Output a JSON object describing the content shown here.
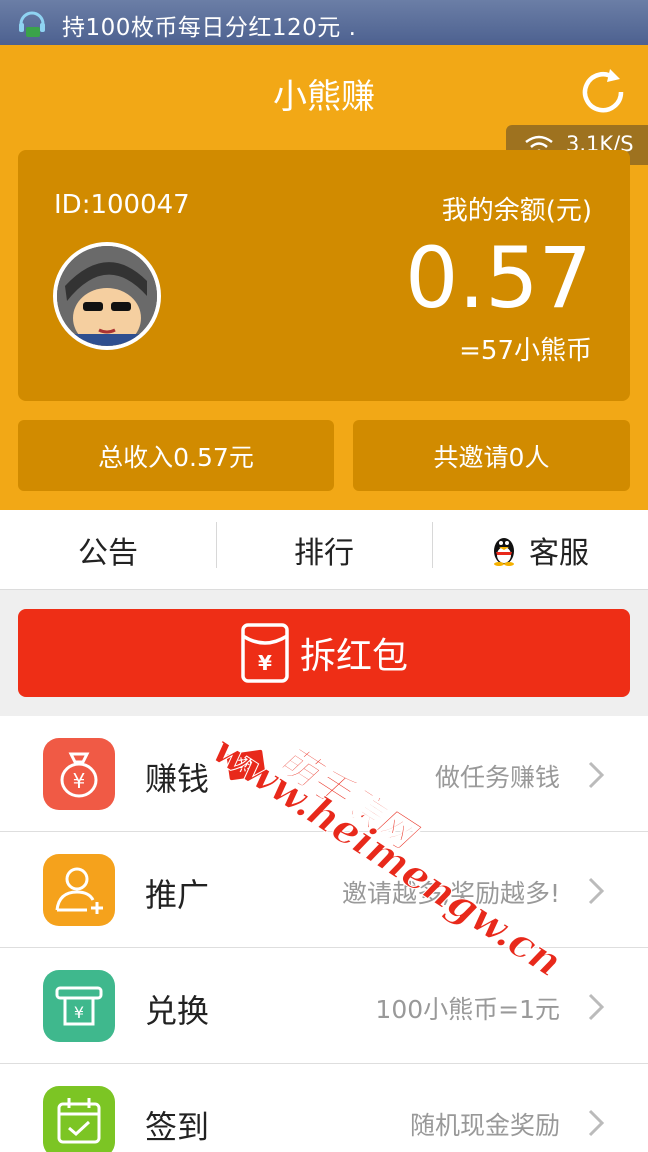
{
  "status_bar": {
    "ticker": "持100枚币每日分红120元 ."
  },
  "header": {
    "title": "小熊赚",
    "network_speed": "3.1K/S"
  },
  "account": {
    "id": "ID:100047",
    "balance_label": "我的余额(元)",
    "balance": "0.57",
    "coins": "=57小熊币"
  },
  "stats": {
    "total_income": "总收入0.57元",
    "invited": "共邀请0人"
  },
  "nav": {
    "tabs": [
      {
        "label": "公告"
      },
      {
        "label": "排行"
      },
      {
        "label": "客服"
      }
    ]
  },
  "red_packet": {
    "label": "拆红包"
  },
  "menu": [
    {
      "label": "赚钱",
      "desc": "做任务赚钱",
      "badge": "热",
      "color": "#f05a45",
      "icon": "money-bag-icon"
    },
    {
      "label": "推广",
      "desc": "邀请越多,奖励越多!",
      "color": "#f5a21c",
      "icon": "add-user-icon"
    },
    {
      "label": "兑换",
      "desc": "100小熊币=1元",
      "color": "#3fb88d",
      "icon": "atm-cash-icon"
    },
    {
      "label": "签到",
      "desc": "随机现金奖励",
      "color": "#7cc524",
      "icon": "calendar-check-icon"
    }
  ],
  "watermark": {
    "line1": "萌手赚网",
    "line2": "www.heimengw.cn"
  },
  "colors": {
    "primary": "#f2a816",
    "card": "#d18b00",
    "red": "#ee2e16"
  }
}
